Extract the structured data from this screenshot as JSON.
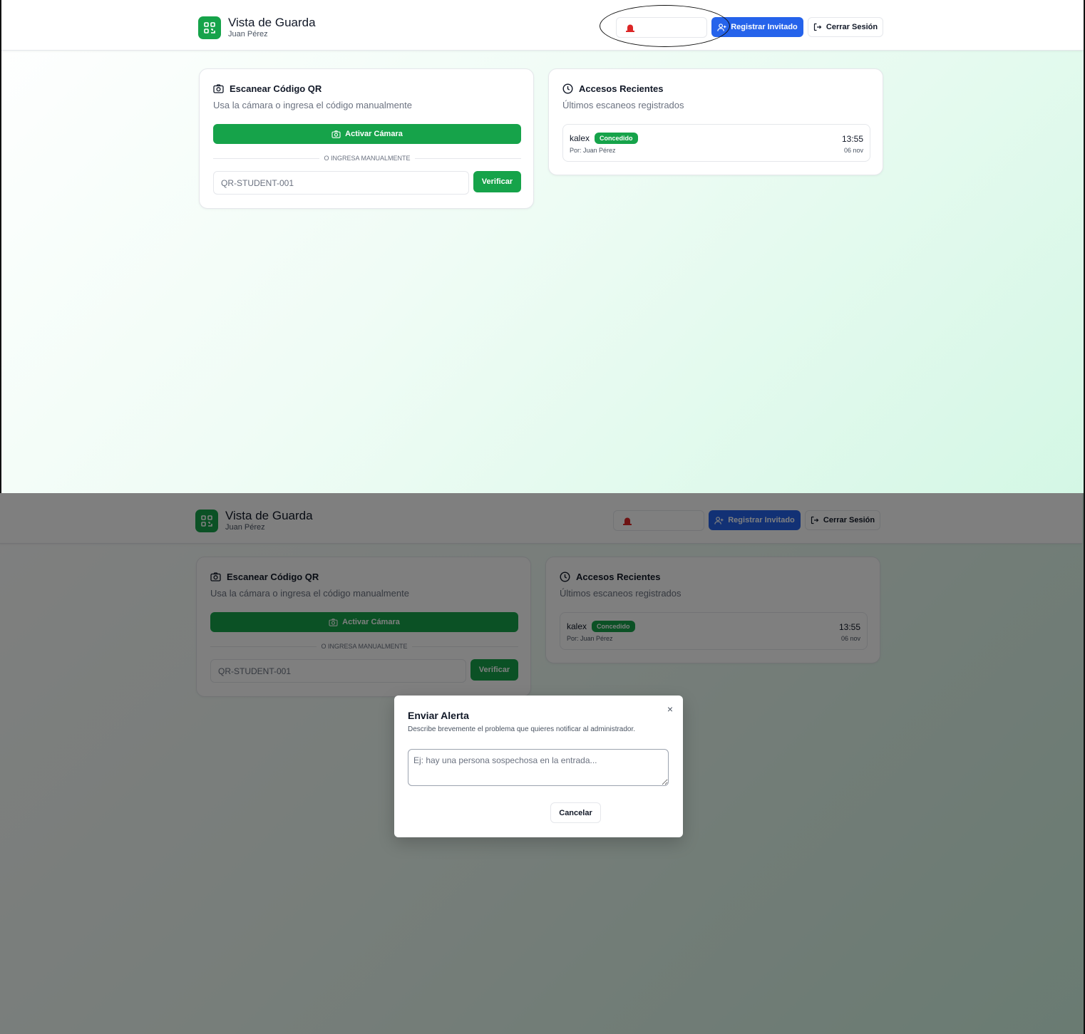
{
  "header": {
    "title": "Vista de Guarda",
    "user": "Juan Pérez",
    "alert_icon": "siren-icon",
    "register_label": "Registrar Invitado",
    "logout_label": "Cerrar Sesión"
  },
  "scan_card": {
    "title": "Escanear Código QR",
    "subtitle": "Usa la cámara o ingresa el código manualmente",
    "camera_label": "Activar Cámara",
    "divider_label": "O INGRESA MANUALMENTE",
    "input_placeholder": "QR-STUDENT-001",
    "verify_label": "Verificar"
  },
  "recent_card": {
    "title": "Accesos Recientes",
    "subtitle": "Últimos escaneos registrados",
    "items": [
      {
        "name": "kalex",
        "status": "Concedido",
        "by": "Por: Juan Pérez",
        "time": "13:55",
        "date": "06 nov"
      }
    ]
  },
  "modal": {
    "title": "Enviar Alerta",
    "description": "Describe brevemente el problema que quieres notificar al administrador.",
    "textarea_placeholder": "Ej: hay una persona sospechosa en la entrada...",
    "cancel_label": "Cancelar",
    "close_symbol": "×"
  },
  "colors": {
    "brand_green": "#16a34a",
    "primary_blue": "#2563eb",
    "alert_red": "#dc2626"
  }
}
